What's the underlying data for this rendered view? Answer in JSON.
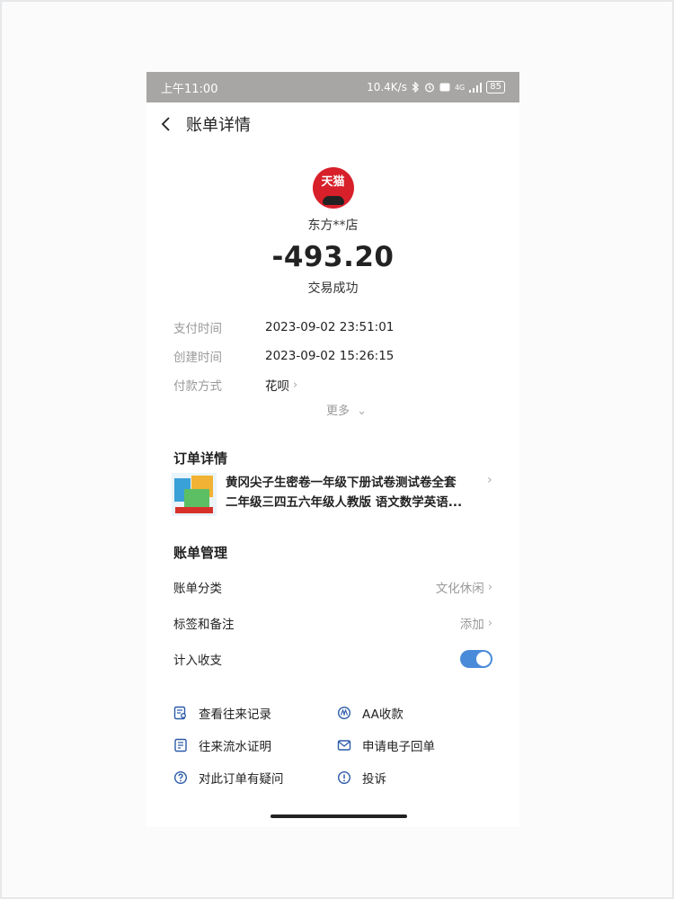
{
  "status_bar": {
    "time": "上午11:00",
    "speed": "10.4K/s",
    "network": "4G",
    "battery": "85"
  },
  "header": {
    "title": "账单详情"
  },
  "merchant": {
    "logo_text": "天猫",
    "name": "东方**店",
    "amount": "-493.20",
    "status": "交易成功"
  },
  "info": {
    "rows": [
      {
        "label": "支付时间",
        "value": "2023-09-02 23:51:01"
      },
      {
        "label": "创建时间",
        "value": "2023-09-02 15:26:15"
      },
      {
        "label": "付款方式",
        "value": "花呗"
      }
    ],
    "more": "更多"
  },
  "order": {
    "section_title": "订单详情",
    "item_title_line1": "黄冈尖子生密卷一年级下册试卷测试卷全套",
    "item_title_line2": "二年级三四五六年级人教版 语文数学英语..."
  },
  "manage": {
    "section_title": "账单管理",
    "category_label": "账单分类",
    "category_value": "文化休闲",
    "tags_label": "标签和备注",
    "tags_value": "添加",
    "count_label": "计入收支",
    "count_enabled": true
  },
  "actions": {
    "history": "查看往来记录",
    "aa": "AA收款",
    "proof": "往来流水证明",
    "receipt": "申请电子回单",
    "question": "对此订单有疑问",
    "complain": "投诉"
  },
  "colors": {
    "accent": "#4a8bd9",
    "brand_red": "#d8202a",
    "status_bar": "#a7a6a4"
  }
}
